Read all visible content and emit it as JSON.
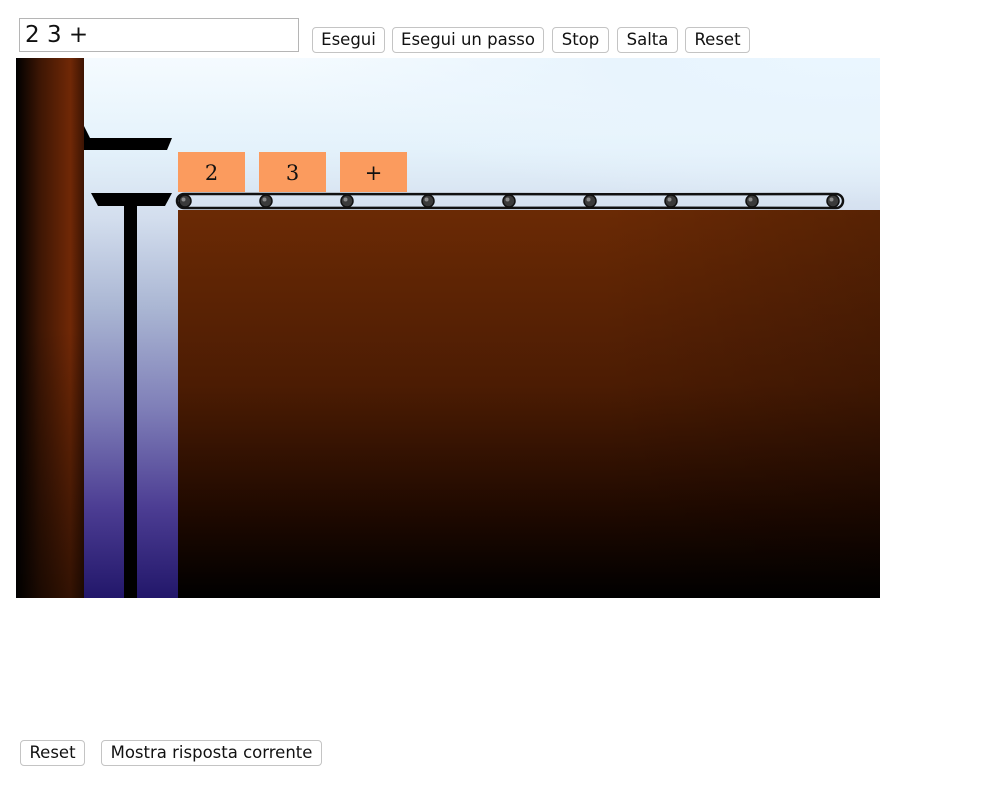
{
  "toolbar": {
    "expression_value": "2 3 +",
    "run_label": "Esegui",
    "step_label": "Esegui un passo",
    "stop_label": "Stop",
    "skip_label": "Salta",
    "reset_label": "Reset"
  },
  "scene": {
    "tokens": [
      "2",
      "3",
      "+"
    ],
    "colors": {
      "token": "#fb9b5e",
      "ground": "#6b2a05",
      "sky": "#e4f2fb",
      "pit": "#22176a"
    }
  },
  "footer": {
    "reset_label": "Reset",
    "show_answer_label": "Mostra risposta corrente"
  }
}
